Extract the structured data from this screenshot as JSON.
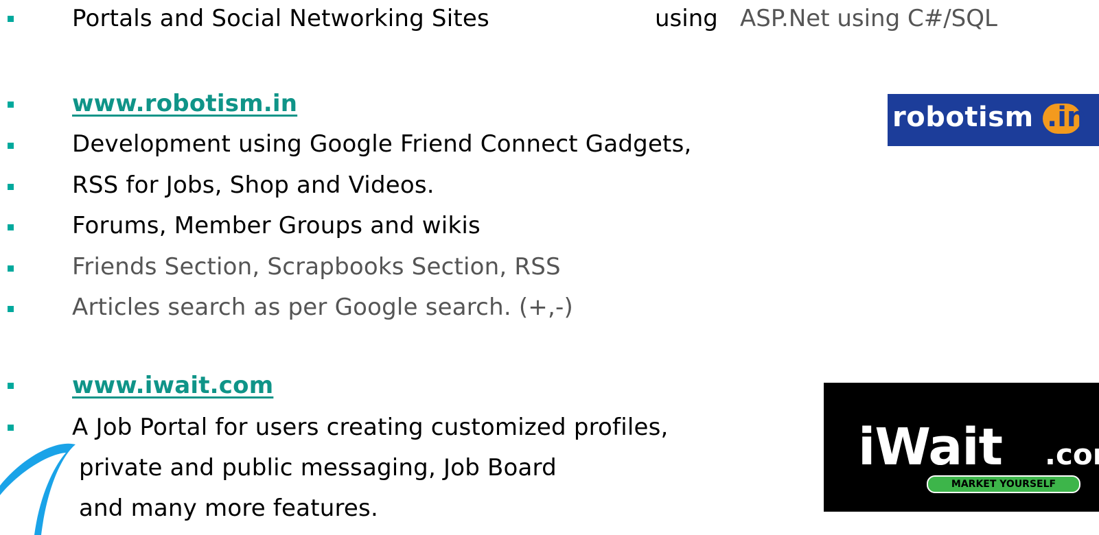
{
  "lines": {
    "portals": "Portals and Social Networking Sites",
    "portals_tech_prefix": "using",
    "portals_tech": "ASP.Net using C#/SQL",
    "robotism_link": "www.robotism.in",
    "robotism_1": "Development using Google Friend Connect Gadgets,",
    "robotism_2": "RSS for Jobs, Shop and Videos.",
    "robotism_3": "Forums, Member Groups and wikis",
    "robotism_4": "Friends Section, Scrapbooks Section, RSS",
    "robotism_5": "Articles search as per Google search. (+,-)",
    "iwait_link": "www.iwait.com",
    "iwait_1": "A Job Portal for users creating customized profiles,",
    "iwait_2": "private and public messaging, Job Board",
    "iwait_3": "and many more features."
  },
  "logos": {
    "robotism_word": "robotism",
    "robotism_tld": ".in",
    "iwait_brand": "iWait",
    "iwait_tld": ".com",
    "iwait_tagline": "MARKET YOURSELF"
  },
  "colors": {
    "bullet": "#00a99d",
    "link": "#0f9488",
    "robotism_bg": "#1c3d9a",
    "robotism_badge": "#f39a1e",
    "iwait_bg": "#000000",
    "iwait_tag": "#3db54a",
    "swoosh": "#1aa3e8"
  },
  "icons": {
    "bullet": "square-bullet-icon",
    "corner_decoration": "swoosh-icon"
  }
}
